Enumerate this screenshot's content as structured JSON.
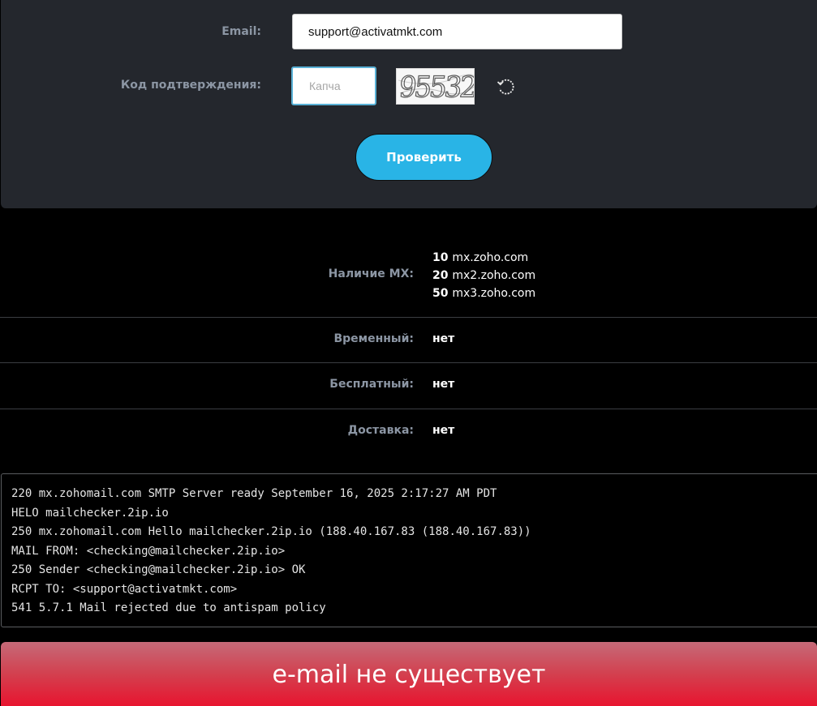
{
  "form": {
    "email_label": "Email:",
    "email_value": "support@activatmkt.com",
    "code_label": "Код подтверждения:",
    "captcha_placeholder": "Капча",
    "captcha_image_text": "95532",
    "refresh_icon": "refresh-icon",
    "check_button_label": "Проверить"
  },
  "results": {
    "mx_label": "Наличие MX:",
    "mx_records": [
      {
        "priority": "10",
        "host": "mx.zoho.com"
      },
      {
        "priority": "20",
        "host": "mx2.zoho.com"
      },
      {
        "priority": "50",
        "host": "mx3.zoho.com"
      }
    ],
    "temporary_label": "Временный:",
    "temporary_value": "нет",
    "free_label": "Бесплатный:",
    "free_value": "нет",
    "delivery_label": "Доставка:",
    "delivery_value": "нет"
  },
  "smtp_log": [
    "220 mx.zohomail.com SMTP Server ready September 16, 2025 2:17:27 AM PDT",
    "HELO mailchecker.2ip.io",
    "250 mx.zohomail.com Hello mailchecker.2ip.io (188.40.167.83 (188.40.167.83))",
    "MAIL FROM: <checking@mailchecker.2ip.io>",
    "250 Sender <checking@mailchecker.2ip.io> OK",
    "RCPT TO: <support@activatmkt.com>",
    "541 5.7.1 Mail rejected due to antispam policy"
  ],
  "result_banner": {
    "text": "e-mail не существует"
  },
  "colors": {
    "panel_bg": "#24272d",
    "label": "#8c96a4",
    "accent_button": "#29b4e6",
    "captcha_border": "#5ab1d6",
    "banner_top": "#c56a78",
    "banner_bottom": "#e8142f"
  }
}
